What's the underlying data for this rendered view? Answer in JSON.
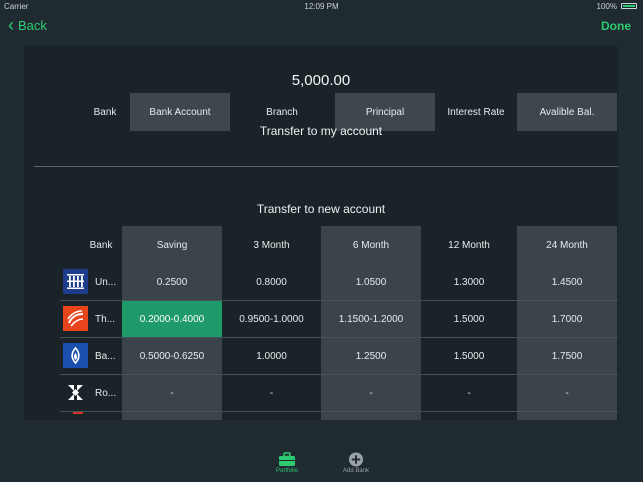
{
  "status_bar": {
    "carrier": "Carrier",
    "time": "12:09 PM",
    "battery": "100%"
  },
  "nav": {
    "back_label": "Back",
    "done_label": "Done"
  },
  "amount": "5,000.00",
  "account_header": {
    "columns": [
      "Bank",
      "Bank Account",
      "Branch",
      "Principal",
      "Interest Rate",
      "Avalible Bal."
    ]
  },
  "transfer_my_account": "Transfer to my account",
  "transfer_new_account": "Transfer to new account",
  "rate_table": {
    "headers": [
      "Bank",
      "Saving",
      "3 Month",
      "6 Month",
      "12 Month",
      "24 Month"
    ],
    "rows": [
      {
        "bank": "Un...",
        "icon": "bank-stripes-icon",
        "cells": [
          "0.2500",
          "0.8000",
          "1.0500",
          "1.3000",
          "1.4500"
        ]
      },
      {
        "bank": "Th...",
        "icon": "bank-swirl-icon",
        "cells": [
          "0.2000-0.4000",
          "0.9500-1.0000",
          "1.1500-1.2000",
          "1.5000",
          "1.7000"
        ]
      },
      {
        "bank": "Ba...",
        "icon": "bank-lotus-icon",
        "cells": [
          "0.5000-0.6250",
          "1.0000",
          "1.2500",
          "1.5000",
          "1.7500"
        ]
      },
      {
        "bank": "Ro...",
        "icon": "bank-chevrons-icon",
        "cells": [
          "-",
          "-",
          "-",
          "-",
          "-"
        ]
      }
    ]
  },
  "tabs": [
    {
      "label": "Portfolio",
      "icon": "briefcase-icon",
      "active": true
    },
    {
      "label": "Add Bank",
      "icon": "add-circle-icon",
      "active": false
    }
  ],
  "colors": {
    "accent": "#2ecc71",
    "highlight_cell": "#1f9a6a"
  }
}
